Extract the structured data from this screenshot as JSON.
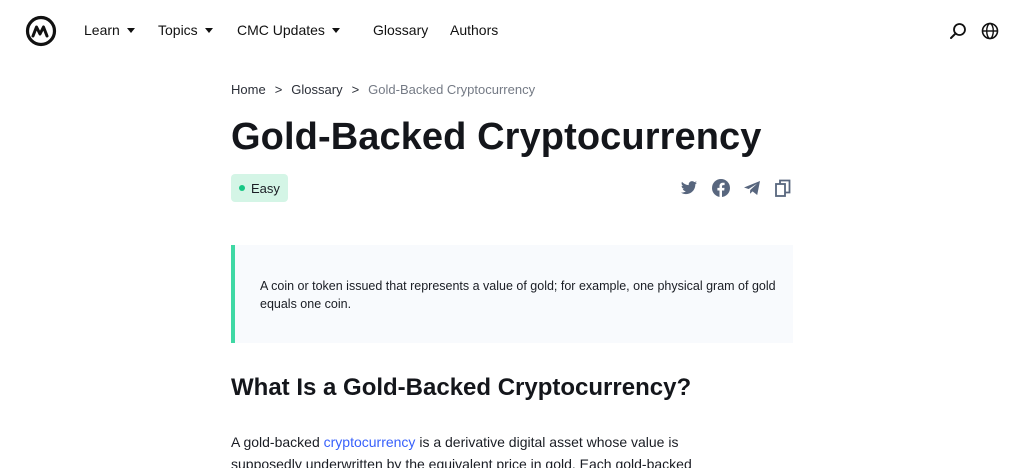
{
  "nav": {
    "items": [
      {
        "label": "Learn",
        "has_caret": true
      },
      {
        "label": "Topics",
        "has_caret": true
      },
      {
        "label": "CMC Updates",
        "has_caret": true
      },
      {
        "label": "Glossary",
        "has_caret": false
      },
      {
        "label": "Authors",
        "has_caret": false
      }
    ],
    "icons": [
      "search-icon",
      "globe-icon"
    ]
  },
  "breadcrumb": {
    "home": "Home",
    "sep1": ">",
    "glossary": "Glossary",
    "sep2": ">",
    "current": "Gold-Backed Cryptocurrency"
  },
  "article": {
    "title": "Gold-Backed Cryptocurrency",
    "difficulty": "Easy",
    "summary": "A coin or token issued that represents a value of gold; for example, one physical gram of gold equals one coin.",
    "heading": "What Is a Gold-Backed Cryptocurrency?",
    "body_start": "A gold-backed ",
    "body_link": "cryptocurrency",
    "body_rest": " is a derivative digital asset whose value is supposedly underwritten by the equivalent price in gold. Each gold-backed"
  },
  "share_icons": [
    "twitter-icon",
    "facebook-icon",
    "telegram-icon",
    "copy-icon"
  ],
  "colors": {
    "accent_green": "#16c784",
    "badge_bg": "#d4f5e6",
    "quote_border": "#3fd8a4",
    "quote_bg": "#f8fafd",
    "link": "#3861fb"
  }
}
